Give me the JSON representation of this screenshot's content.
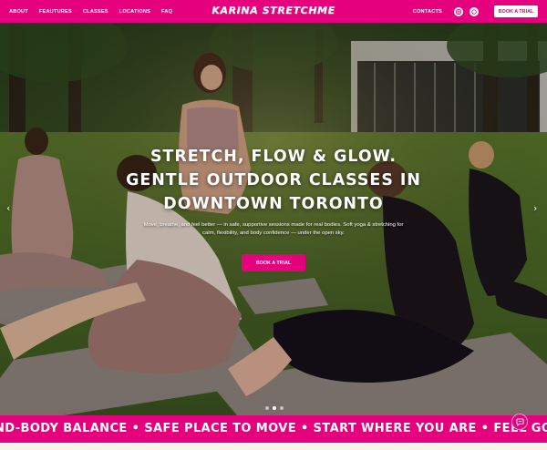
{
  "nav": {
    "links": [
      "ABOUT",
      "FEAUTURES",
      "CLASSES",
      "LOCATIONS",
      "FAQ"
    ],
    "logo": "KARINA STRETCHME",
    "contacts": "CONTACTS",
    "social_icons": [
      "instagram-icon",
      "whatsapp-icon"
    ],
    "cta": "BOOK A TRIAL"
  },
  "hero": {
    "title_lines": [
      "STRETCH, FLOW & GLOW.",
      "GENTLE OUTDOOR CLASSES IN",
      "DOWNTOWN TORONTO"
    ],
    "subtitle": "Move, breathe, and feel better — in safe, supportive sessions made for real bodies. Soft yoga & stretching for calm, flexibility, and body confidence — under the open sky.",
    "cta": "BOOK A TRIAL",
    "prev_arrow": "‹",
    "next_arrow": "›",
    "slides_total": 3,
    "active_slide": 2
  },
  "marquee": {
    "text": "ND-BODY BALANCE • SAFE PLACE TO MOVE • START WHERE YOU ARE • FEEL GOOD IN YOUR BODY • CA"
  },
  "colors": {
    "brand": "#e5007e",
    "white": "#ffffff"
  }
}
